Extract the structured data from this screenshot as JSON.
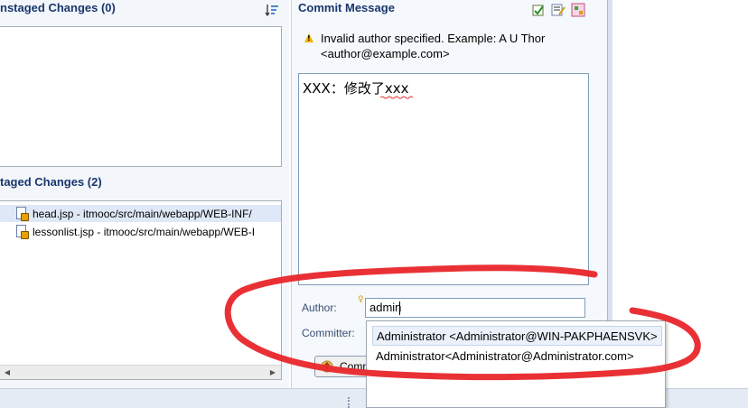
{
  "unstaged": {
    "title": "nstaged Changes (0)",
    "sort_icon": "sort-icon"
  },
  "staged": {
    "title": "taged Changes (2)",
    "files": [
      {
        "label": "head.jsp - itmooc/src/main/webapp/WEB-INF/",
        "icon": "jsp-file-icon"
      },
      {
        "label": "lessonlist.jsp - itmooc/src/main/webapp/WEB-I",
        "icon": "jsp-file-icon"
      }
    ]
  },
  "commit": {
    "title": "Commit Message",
    "warning_line1": "Invalid author specified. Example: A U Thor",
    "warning_line2": "<author@example.com>",
    "message": "XXX：修改了xxx",
    "author_label": "Author:",
    "author_value": "admin",
    "committer_label": "Committer:",
    "commit_button": "Commi",
    "toolbar_icons": [
      "add-signoff-icon",
      "amend-icon",
      "settings-icon"
    ]
  },
  "autocomplete": {
    "options": [
      "Administrator <Administrator@WIN-PAKPHAENSVK>",
      "Administrator<Administrator@Administrator.com>"
    ]
  },
  "colors": {
    "annotation": "#e8262a",
    "title": "#19376d"
  }
}
